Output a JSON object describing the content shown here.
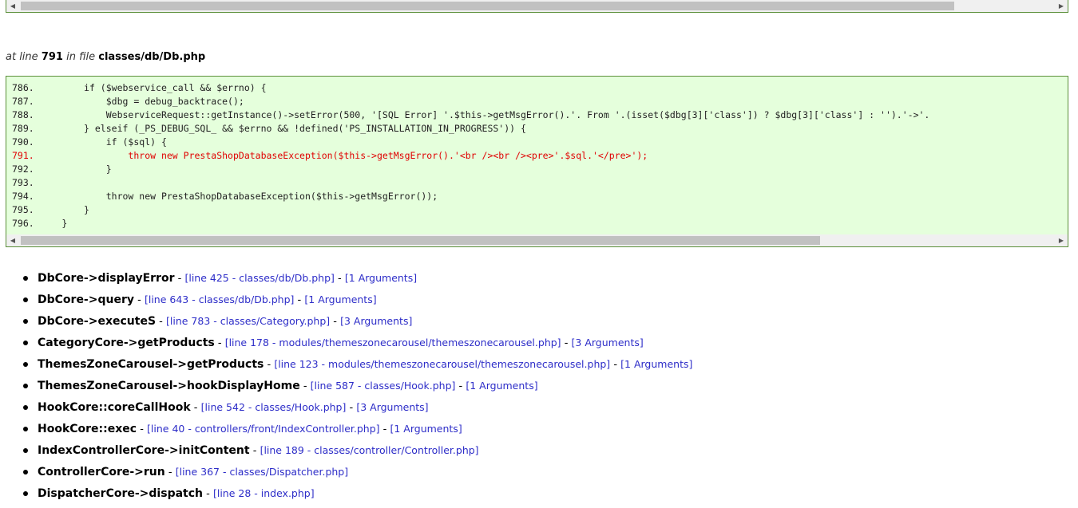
{
  "location": {
    "prefix": "at line",
    "line": "791",
    "mid": "in file",
    "file": "classes/db/Db.php"
  },
  "code": [
    {
      "num": "786.",
      "text": "        if ($webservice_call && $errno) {",
      "error": false
    },
    {
      "num": "787.",
      "text": "            $dbg = debug_backtrace();",
      "error": false
    },
    {
      "num": "788.",
      "text": "            WebserviceRequest::getInstance()->setError(500, '[SQL Error] '.$this->getMsgError().'. From '.(isset($dbg[3]['class']) ? $dbg[3]['class'] : '').'->'.",
      "error": false
    },
    {
      "num": "789.",
      "text": "        } elseif (_PS_DEBUG_SQL_ && $errno && !defined('PS_INSTALLATION_IN_PROGRESS')) {",
      "error": false
    },
    {
      "num": "790.",
      "text": "            if ($sql) {",
      "error": false
    },
    {
      "num": "791.",
      "text": "                throw new PrestaShopDatabaseException($this->getMsgError().'<br /><br /><pre>'.$sql.'</pre>');",
      "error": true
    },
    {
      "num": "792.",
      "text": "            }",
      "error": false
    },
    {
      "num": "793.",
      "text": "",
      "error": false
    },
    {
      "num": "794.",
      "text": "            throw new PrestaShopDatabaseException($this->getMsgError());",
      "error": false
    },
    {
      "num": "795.",
      "text": "        }",
      "error": false
    },
    {
      "num": "796.",
      "text": "    }",
      "error": false
    }
  ],
  "trace": [
    {
      "fn": "DbCore->displayError",
      "loc": "[line 425 - classes/db/Db.php]",
      "args": "[1 Arguments]"
    },
    {
      "fn": "DbCore->query",
      "loc": "[line 643 - classes/db/Db.php]",
      "args": "[1 Arguments]"
    },
    {
      "fn": "DbCore->executeS",
      "loc": "[line 783 - classes/Category.php]",
      "args": "[3 Arguments]"
    },
    {
      "fn": "CategoryCore->getProducts",
      "loc": "[line 178 - modules/themeszonecarousel/themeszonecarousel.php]",
      "args": "[3 Arguments]"
    },
    {
      "fn": "ThemesZoneCarousel->getProducts",
      "loc": "[line 123 - modules/themeszonecarousel/themeszonecarousel.php]",
      "args": "[1 Arguments]"
    },
    {
      "fn": "ThemesZoneCarousel->hookDisplayHome",
      "loc": "[line 587 - classes/Hook.php]",
      "args": "[1 Arguments]"
    },
    {
      "fn": "HookCore::coreCallHook",
      "loc": "[line 542 - classes/Hook.php]",
      "args": "[3 Arguments]"
    },
    {
      "fn": "HookCore::exec",
      "loc": "[line 40 - controllers/front/IndexController.php]",
      "args": "[1 Arguments]"
    },
    {
      "fn": "IndexControllerCore->initContent",
      "loc": "[line 189 - classes/controller/Controller.php]",
      "args": ""
    },
    {
      "fn": "ControllerCore->run",
      "loc": "[line 367 - classes/Dispatcher.php]",
      "args": ""
    },
    {
      "fn": "DispatcherCore->dispatch",
      "loc": "[line 28 - index.php]",
      "args": ""
    }
  ],
  "separator": " - ",
  "icons": {
    "scroll_left": "chevron-left-icon",
    "scroll_right": "chevron-right-icon"
  }
}
